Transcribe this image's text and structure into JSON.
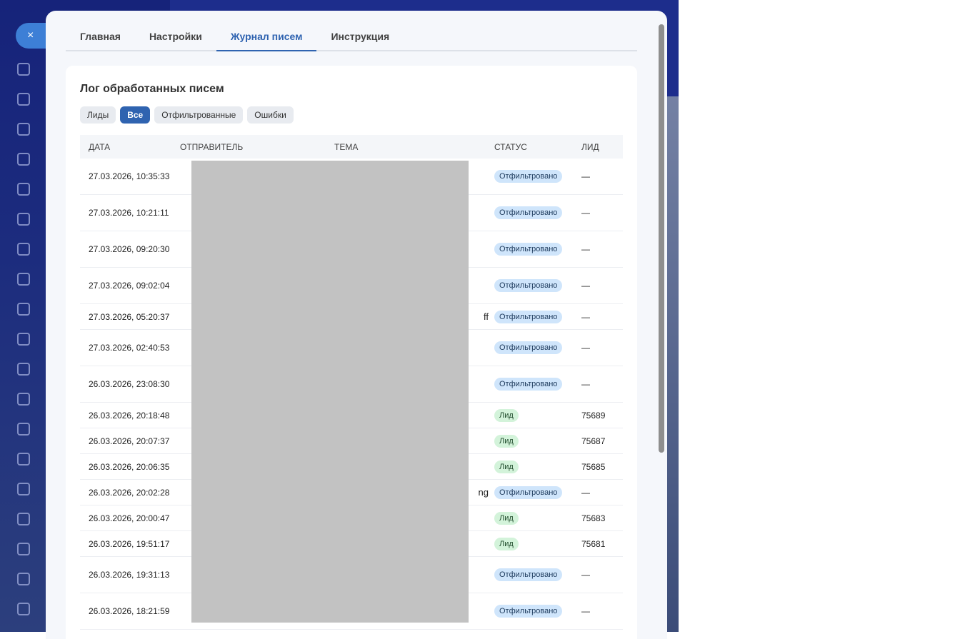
{
  "tabs": [
    "Главная",
    "Настройки",
    "Журнал писем",
    "Инструкция"
  ],
  "active_tab": 2,
  "card_title": "Лог обработанных писем",
  "filters": [
    "Лиды",
    "Все",
    "Отфильтрованные",
    "Ошибки"
  ],
  "active_filter": 1,
  "columns": [
    "ДАТА",
    "ОТПРАВИТЕЛЬ",
    "ТЕМА",
    "СТАТУС",
    "ЛИД"
  ],
  "rows": [
    {
      "date": "27.03.2026, 10:35:33",
      "subject": "",
      "status": "Отфильтровано",
      "type": "f",
      "lead": "—",
      "tall": true
    },
    {
      "date": "27.03.2026, 10:21:11",
      "subject": "",
      "status": "Отфильтровано",
      "type": "f",
      "lead": "—",
      "tall": true
    },
    {
      "date": "27.03.2026, 09:20:30",
      "subject": "",
      "status": "Отфильтровано",
      "type": "f",
      "lead": "—",
      "tall": true
    },
    {
      "date": "27.03.2026, 09:02:04",
      "subject": "",
      "status": "Отфильтровано",
      "type": "f",
      "lead": "—",
      "tall": true
    },
    {
      "date": "27.03.2026, 05:20:37",
      "subject": "ff",
      "status": "Отфильтровано",
      "type": "f",
      "lead": "—",
      "tall": false
    },
    {
      "date": "27.03.2026, 02:40:53",
      "subject": "",
      "status": "Отфильтровано",
      "type": "f",
      "lead": "—",
      "tall": true
    },
    {
      "date": "26.03.2026, 23:08:30",
      "subject": "",
      "status": "Отфильтровано",
      "type": "f",
      "lead": "—",
      "tall": true
    },
    {
      "date": "26.03.2026, 20:18:48",
      "subject": "",
      "status": "Лид",
      "type": "l",
      "lead": "75689",
      "tall": false
    },
    {
      "date": "26.03.2026, 20:07:37",
      "subject": "",
      "status": "Лид",
      "type": "l",
      "lead": "75687",
      "tall": false
    },
    {
      "date": "26.03.2026, 20:06:35",
      "subject": "",
      "status": "Лид",
      "type": "l",
      "lead": "75685",
      "tall": false
    },
    {
      "date": "26.03.2026, 20:02:28",
      "subject": "ng",
      "status": "Отфильтровано",
      "type": "f",
      "lead": "—",
      "tall": false
    },
    {
      "date": "26.03.2026, 20:00:47",
      "subject": "",
      "status": "Лид",
      "type": "l",
      "lead": "75683",
      "tall": false
    },
    {
      "date": "26.03.2026, 19:51:17",
      "subject": "",
      "status": "Лид",
      "type": "l",
      "lead": "75681",
      "tall": false
    },
    {
      "date": "26.03.2026, 19:31:13",
      "subject": "",
      "status": "Отфильтровано",
      "type": "f",
      "lead": "—",
      "tall": true
    },
    {
      "date": "26.03.2026, 18:21:59",
      "subject": "",
      "status": "Отфильтровано",
      "type": "f",
      "lead": "—",
      "tall": true
    }
  ],
  "close_icon": "×"
}
